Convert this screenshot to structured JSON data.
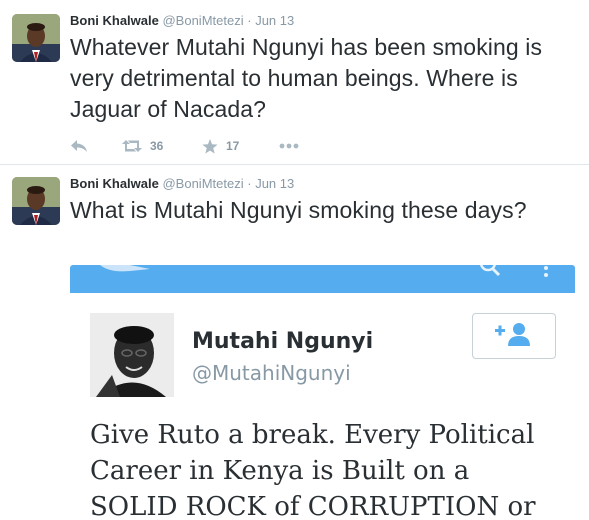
{
  "colors": {
    "link_blue": "#55acee",
    "muted": "#8899a6",
    "text": "#292f33",
    "divider": "#e1e8ed"
  },
  "tweets": [
    {
      "author_name": "Boni Khalwale",
      "author_handle": "@BoniMtetezi",
      "separator": "·",
      "time": "Jun 13",
      "text": "Whatever Mutahi Ngunyi has been smoking is very detrimental to human beings. Where is Jaguar of Nacada?",
      "retweets": "36",
      "favorites": "17",
      "icons": [
        "reply-icon",
        "retweet-icon",
        "favorite-icon",
        "more-icon"
      ]
    },
    {
      "author_name": "Boni Khalwale",
      "author_handle": "@BoniMtetezi",
      "separator": "·",
      "time": "Jun 13",
      "text": "What is Mutahi Ngunyi smoking these days?",
      "embed": {
        "name": "Mutahi Ngunyi",
        "handle": "@MutahiNgunyi",
        "text": "Give Ruto a break. Every Political Career in Kenya is Built on a SOLID ROCK of CORRUPTION or"
      }
    }
  ]
}
